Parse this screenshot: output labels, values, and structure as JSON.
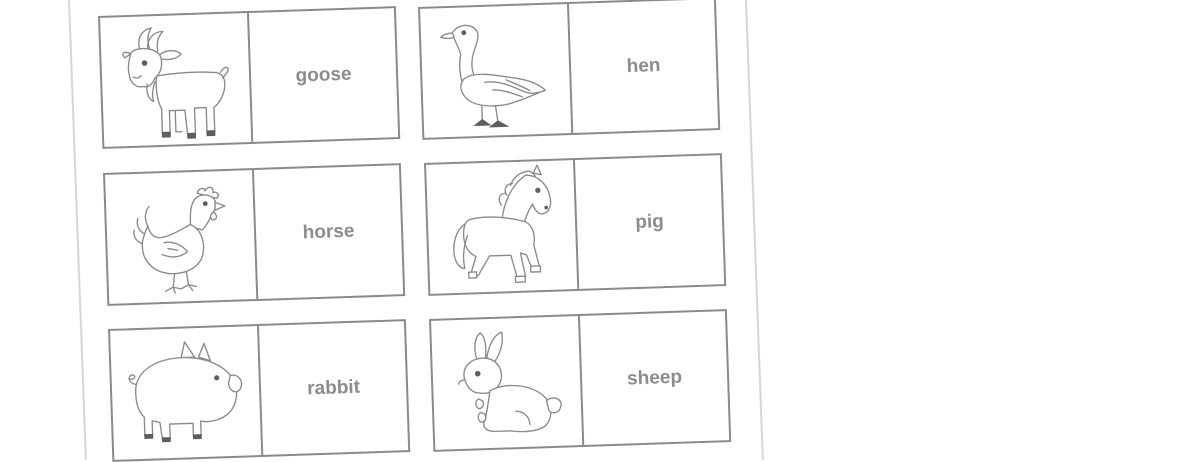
{
  "worksheet": {
    "cards": [
      {
        "picture_icon": "goat-icon",
        "word": "goose"
      },
      {
        "picture_icon": "goose-icon",
        "word": "hen"
      },
      {
        "picture_icon": "hen-icon",
        "word": "horse"
      },
      {
        "picture_icon": "horse-icon",
        "word": "pig"
      },
      {
        "picture_icon": "pig-icon",
        "word": "rabbit"
      },
      {
        "picture_icon": "rabbit-icon",
        "word": "sheep"
      }
    ]
  },
  "colors": {
    "line": "#8a8a8a",
    "text": "#8c8c8c",
    "paper_edge": "#d6d6d6",
    "background": "#ffffff"
  }
}
